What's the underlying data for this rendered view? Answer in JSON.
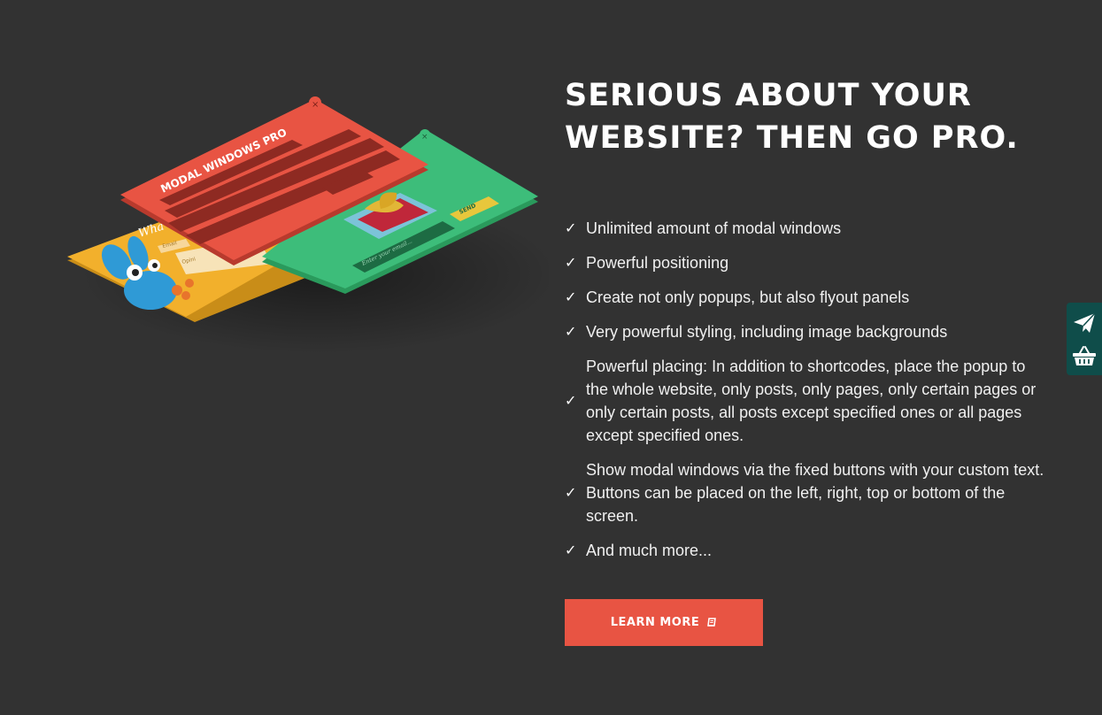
{
  "headline": "SERIOUS ABOUT YOUR WEBSITE? THEN GO PRO.",
  "features": [
    "Unlimited amount of modal windows",
    "Powerful positioning",
    "Create not only popups, but also flyout panels",
    "Very powerful styling, including image backgrounds",
    "Powerful placing: In addition to shortcodes, place the popup to the whole website, only posts, only pages, only certain pages or only certain posts, all posts except specified ones or all pages except specified ones.",
    "Show modal windows via the fixed buttons with your custom text. Buttons can be placed on the left, right, top or bottom of the screen.",
    "And much more..."
  ],
  "check_glyph": "✓",
  "cta": {
    "label": "LEARN MORE",
    "icon": "book-icon",
    "color": "#e85443"
  },
  "illustration": {
    "red_window_title": "MODAL WINDOWS PRO",
    "green_input_placeholder": "Enter your email...",
    "green_button_label": "SEND",
    "yellow_heading": "Wha",
    "yellow_field_1": "Email",
    "yellow_field_2": "Opini",
    "colors": {
      "red": "#e85443",
      "green": "#3dbd7a",
      "yellow": "#f2b02c"
    }
  },
  "side_buttons": [
    {
      "icon": "paper-plane-icon"
    },
    {
      "icon": "basket-icon"
    }
  ],
  "colors": {
    "background": "#323232",
    "side_bar": "#0f4d4a"
  }
}
